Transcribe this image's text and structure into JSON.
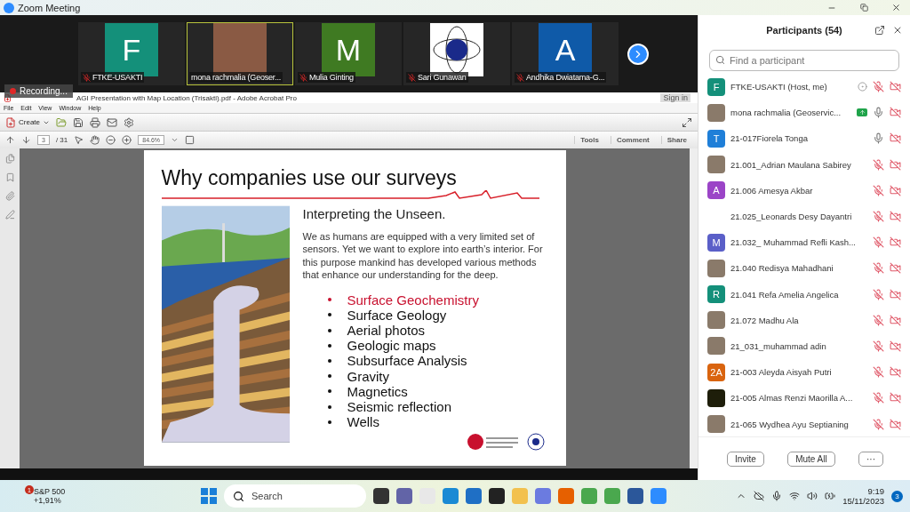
{
  "window": {
    "title": "Zoom Meeting"
  },
  "video_strip": {
    "tiles": [
      {
        "name": "FTKE-USAKTI",
        "muted": true,
        "selected": false,
        "avatar": {
          "kind": "letter",
          "letter": "F",
          "color": "#14907a"
        }
      },
      {
        "name": "mona rachmalia (Geoser...",
        "muted": false,
        "selected": true,
        "avatar": {
          "kind": "photo"
        }
      },
      {
        "name": "Mulia Ginting",
        "muted": true,
        "selected": false,
        "avatar": {
          "kind": "letter",
          "letter": "M",
          "color": "#3f7a22"
        }
      },
      {
        "name": "Sari Gunawan",
        "muted": true,
        "selected": false,
        "avatar": {
          "kind": "logo"
        }
      },
      {
        "name": "Andhika Dwiatama-G...",
        "muted": true,
        "selected": false,
        "avatar": {
          "kind": "letter",
          "letter": "A",
          "color": "#0f5aa8"
        }
      }
    ],
    "recording": "Recording..."
  },
  "acrobat": {
    "title": "AGI Presentation with Map Location (Trisakti).pdf - Adobe Acrobat Pro",
    "sign_in": "Sign in",
    "menu": [
      "File",
      "Edit",
      "View",
      "Window",
      "Help"
    ],
    "create": "Create",
    "page": "3",
    "page_count": "/ 31",
    "zoom": "84.6%",
    "panes": [
      "Tools",
      "Comment",
      "Share"
    ],
    "slide": {
      "title": "Why companies use our surveys",
      "subtitle": "Interpreting the Unseen.",
      "paragraph": "We as humans are equipped with a very limited set of sensors. Yet we want to explore into earth’s interior. For this purpose mankind has developed various methods that enhance our understanding for the deep.",
      "bullets": [
        {
          "text": "Surface Geochemistry",
          "highlighted": true
        },
        {
          "text": "Surface Geology",
          "highlighted": false
        },
        {
          "text": "Aerial photos",
          "highlighted": false
        },
        {
          "text": "Geologic maps",
          "highlighted": false
        },
        {
          "text": "Subsurface Analysis",
          "highlighted": false
        },
        {
          "text": "Gravity",
          "highlighted": false
        },
        {
          "text": "Magnetics",
          "highlighted": false
        },
        {
          "text": "Seismic reflection",
          "highlighted": false
        },
        {
          "text": "Wells",
          "highlighted": false
        }
      ]
    }
  },
  "participants": {
    "title": "Participants (54)",
    "search": {
      "placeholder": "Find a participant"
    },
    "rows": [
      {
        "name": "FTKE-USAKTI (Host, me)",
        "avatar": {
          "kind": "letter",
          "letter": "F",
          "color": "#14907a"
        },
        "spotlight": true,
        "sharing": false,
        "muted": true
      },
      {
        "name": "mona rachmalia (Geoservic...",
        "avatar": {
          "kind": "photo"
        },
        "spotlight": false,
        "sharing": true,
        "muted": false
      },
      {
        "name": "21-017Fiorela Tonga",
        "avatar": {
          "kind": "letter",
          "letter": "T",
          "color": "#1f7fd8"
        },
        "muted": false
      },
      {
        "name": "21.001_Adrian Maulana Sabirey",
        "avatar": {
          "kind": "photo"
        },
        "muted": true
      },
      {
        "name": "21.006 Amesya Akbar",
        "avatar": {
          "kind": "letter",
          "letter": "A",
          "color": "#9b44c7"
        },
        "muted": true
      },
      {
        "name": "21.025_Leonards Desy Dayantri",
        "avatar": {
          "kind": "none"
        },
        "muted": true
      },
      {
        "name": "21.032_ Muhammad Refli Kash...",
        "avatar": {
          "kind": "letter",
          "letter": "M",
          "color": "#5a5fc8"
        },
        "muted": true
      },
      {
        "name": "21.040 Redisya Mahadhani",
        "avatar": {
          "kind": "photo"
        },
        "muted": true
      },
      {
        "name": "21.041 Refa Amelia Angelica",
        "avatar": {
          "kind": "letter",
          "letter": "R",
          "color": "#14907a"
        },
        "muted": true
      },
      {
        "name": "21.072 Madhu Ala",
        "avatar": {
          "kind": "photo"
        },
        "muted": true
      },
      {
        "name": "21_031_muhammad adin",
        "avatar": {
          "kind": "photo"
        },
        "muted": true
      },
      {
        "name": "21-003 Aleyda Aisyah Putri",
        "avatar": {
          "kind": "letter",
          "letter": "2A",
          "color": "#d9640f"
        },
        "muted": true
      },
      {
        "name": "21-005 Almas Renzi Maorilla A...",
        "avatar": {
          "kind": "letter",
          "color": "#1e1e0a"
        },
        "muted": true
      },
      {
        "name": "21-065 Wydhea Ayu Septianing",
        "avatar": {
          "kind": "photo"
        },
        "muted": true
      }
    ],
    "buttons": [
      "Invite",
      "Mute All",
      "···"
    ]
  },
  "taskbar": {
    "widget": {
      "name": "S&P 500",
      "change": "+1,91%",
      "badge": "1"
    },
    "search": "Search",
    "time": "9:19",
    "date": "15/11/2023",
    "notifications": "3"
  }
}
